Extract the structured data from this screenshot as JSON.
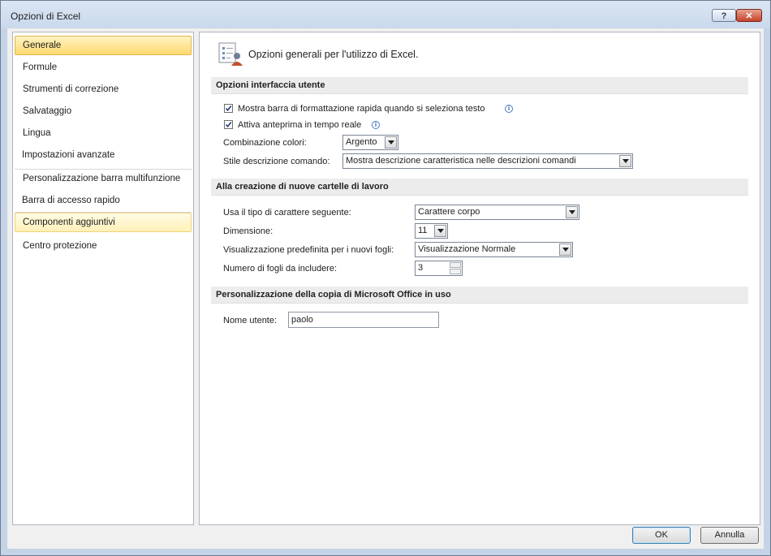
{
  "window": {
    "title": "Opzioni di Excel",
    "help_label": "?",
    "close_label": "✕"
  },
  "nav": {
    "items": [
      {
        "label": "Generale",
        "state": "selected"
      },
      {
        "label": "Formule"
      },
      {
        "label": "Strumenti di correzione"
      },
      {
        "label": "Salvataggio"
      },
      {
        "label": "Lingua"
      },
      {
        "label": "Impostazioni avanzate"
      },
      {
        "label": "Personalizzazione barra multifunzione"
      },
      {
        "label": "Barra di accesso rapido"
      },
      {
        "label": "Componenti aggiuntivi",
        "state": "hover"
      },
      {
        "label": "Centro protezione"
      }
    ]
  },
  "main": {
    "heading": "Opzioni generali per l'utilizzo di Excel.",
    "heading_icon": "general-options-icon",
    "sections": {
      "ui": {
        "title": "Opzioni interfaccia utente",
        "mini_toolbar": {
          "label": "Mostra barra di formattazione rapida quando si seleziona testo",
          "checked": true
        },
        "live_preview": {
          "label": "Attiva anteprima in tempo reale",
          "checked": true
        },
        "color_scheme": {
          "label": "Combinazione colori:",
          "value": "Argento"
        },
        "tooltip_style": {
          "label": "Stile descrizione comando:",
          "value": "Mostra descrizione caratteristica nelle descrizioni comandi"
        }
      },
      "new_workbooks": {
        "title": "Alla creazione di nuove cartelle di lavoro",
        "font": {
          "label": "Usa il tipo di carattere seguente:",
          "value": "Carattere corpo"
        },
        "size": {
          "label": "Dimensione:",
          "value": "11"
        },
        "default_view": {
          "label": "Visualizzazione predefinita per i nuovi fogli:",
          "value": "Visualizzazione Normale"
        },
        "sheets": {
          "label": "Numero di fogli da includere:",
          "value": "3"
        }
      },
      "personalize": {
        "title": "Personalizzazione della copia di Microsoft Office in uso",
        "username": {
          "label": "Nome utente:",
          "value": "paolo"
        }
      }
    }
  },
  "buttons": {
    "ok": "OK",
    "cancel": "Annulla"
  },
  "colors": {
    "selected_nav": "#ffd96e",
    "frame": "#c4d3e6",
    "section_bg": "#ececec"
  }
}
